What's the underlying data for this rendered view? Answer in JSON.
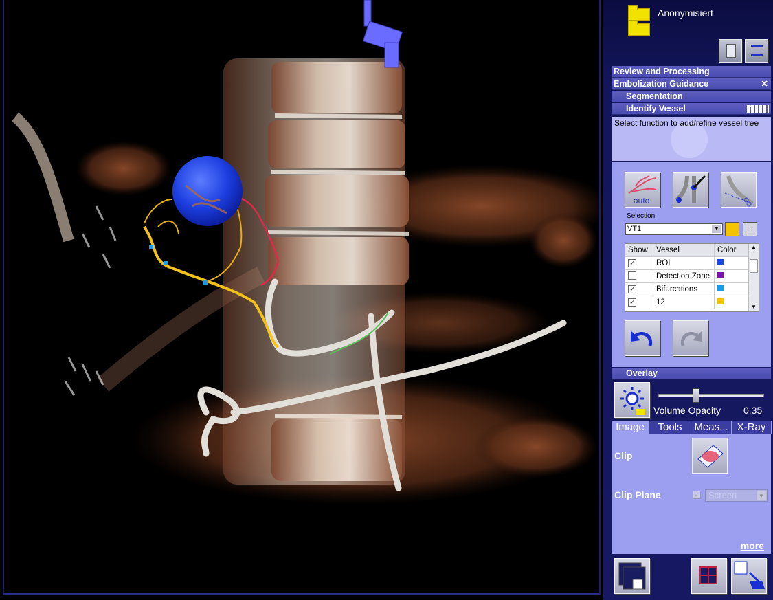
{
  "header": {
    "patient_folder": "Anonymisiert"
  },
  "sections": {
    "review": "Review and Processing",
    "embolization": "Embolization Guidance",
    "segmentation": "Segmentation",
    "identify": "Identify Vessel",
    "overlay": "Overlay"
  },
  "info": {
    "text": "Select function to add/refine vessel tree"
  },
  "tools": {
    "auto_label": "auto"
  },
  "selection": {
    "label": "Selection",
    "value": "VT1",
    "color": "#f5c400",
    "more_label": "..."
  },
  "vessel_table": {
    "headers": [
      "Show",
      "Vessel",
      "Color"
    ],
    "rows": [
      {
        "show": true,
        "name": "ROI",
        "color": "#1746e8"
      },
      {
        "show": false,
        "name": "Detection Zone",
        "color": "#7a16b0"
      },
      {
        "show": true,
        "name": "Bifurcations",
        "color": "#1a9bf0"
      },
      {
        "show": true,
        "name": "12",
        "color": "#f5c400"
      }
    ]
  },
  "overlay": {
    "opacity_label": "Volume Opacity",
    "opacity_value": "0.35",
    "opacity": 0.35
  },
  "tabs": [
    "Image",
    "Tools",
    "Meas...",
    "X-Ray"
  ],
  "image_tab": {
    "clip_label": "Clip",
    "clip_plane_label": "Clip Plane",
    "clip_plane_value": "Screen",
    "more": "more"
  },
  "icons": [
    "folder-icon",
    "close-icon",
    "help-icon",
    "grid-icon",
    "undo-icon",
    "redo-icon",
    "brightness-icon",
    "clip-icon"
  ]
}
